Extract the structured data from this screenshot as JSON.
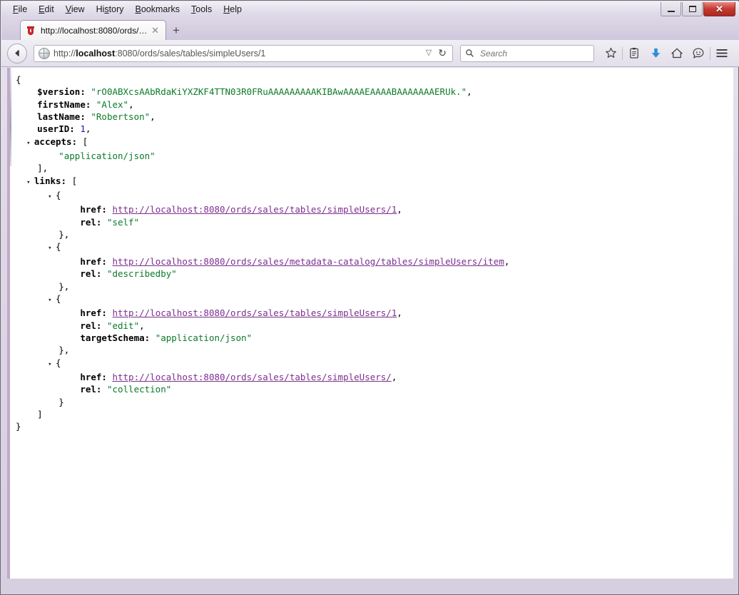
{
  "window": {
    "menubar": [
      {
        "label": "File",
        "accel": "F"
      },
      {
        "label": "Edit",
        "accel": "E"
      },
      {
        "label": "View",
        "accel": "V"
      },
      {
        "label": "History",
        "accel": "s"
      },
      {
        "label": "Bookmarks",
        "accel": "B"
      },
      {
        "label": "Tools",
        "accel": "T"
      },
      {
        "label": "Help",
        "accel": "H"
      }
    ],
    "controls": {
      "minimize": "minimize",
      "maximize": "maximize",
      "close": "✕"
    },
    "frame_color": "#c3a9c8"
  },
  "tabs": {
    "items": [
      {
        "title": "http://localhost:8080/ords/…",
        "favicon": "ords-shield-icon",
        "close_label": "✕"
      }
    ],
    "new_tab_label": "+"
  },
  "navbar": {
    "back_label": "←",
    "url_prefix": "http://",
    "url_host": "localhost",
    "url_rest": ":8080/ords/sales/tables/simpleUsers/1",
    "url_full": "http://localhost:8080/ords/sales/tables/simpleUsers/1",
    "dropdown_label": "▽",
    "reload_label": "↻",
    "search_placeholder": "Search",
    "search_value": "",
    "icons": [
      {
        "name": "bookmark-star-icon",
        "glyph": "☆"
      },
      {
        "name": "reading-list-icon",
        "glyph": "📋"
      },
      {
        "name": "downloads-icon",
        "glyph": "↓"
      },
      {
        "name": "home-icon",
        "glyph": "⌂"
      },
      {
        "name": "sync-chat-icon",
        "glyph": "☺"
      },
      {
        "name": "menu-hamburger-icon",
        "glyph": "≡"
      }
    ],
    "accent_color": "#2f8fd6"
  },
  "json_view": {
    "colors": {
      "key": "#000000",
      "string": "#0b7a28",
      "number": "#1414c8",
      "link": "#7c2f8f"
    },
    "lines": [
      {
        "indent": 0,
        "twisty": "",
        "parts": [
          {
            "t": "brc",
            "v": "{"
          }
        ]
      },
      {
        "indent": 1,
        "twisty": "",
        "parts": [
          {
            "t": "k",
            "v": "$version:"
          },
          {
            "t": "sp",
            "v": " "
          },
          {
            "t": "str",
            "v": "\"rO0ABXcsAAbRdaKiYXZKF4TTN03R0FRuAAAAAAAAAKIBAwAAAAEAAAABAAAAAAAERUk.\""
          },
          {
            "t": "pun",
            "v": ","
          }
        ]
      },
      {
        "indent": 1,
        "twisty": "",
        "parts": [
          {
            "t": "k",
            "v": "firstName:"
          },
          {
            "t": "sp",
            "v": " "
          },
          {
            "t": "str",
            "v": "\"Alex\""
          },
          {
            "t": "pun",
            "v": ","
          }
        ]
      },
      {
        "indent": 1,
        "twisty": "",
        "parts": [
          {
            "t": "k",
            "v": "lastName:"
          },
          {
            "t": "sp",
            "v": " "
          },
          {
            "t": "str",
            "v": "\"Robertson\""
          },
          {
            "t": "pun",
            "v": ","
          }
        ]
      },
      {
        "indent": 1,
        "twisty": "",
        "parts": [
          {
            "t": "k",
            "v": "userID:"
          },
          {
            "t": "sp",
            "v": " "
          },
          {
            "t": "num",
            "v": "1"
          },
          {
            "t": "pun",
            "v": ","
          }
        ]
      },
      {
        "indent": 1,
        "twisty": "▾",
        "parts": [
          {
            "t": "k",
            "v": "accepts:"
          },
          {
            "t": "sp",
            "v": " "
          },
          {
            "t": "brc",
            "v": "["
          }
        ]
      },
      {
        "indent": 2,
        "twisty": "",
        "parts": [
          {
            "t": "str",
            "v": "\"application/json\""
          }
        ]
      },
      {
        "indent": 1,
        "twisty": "",
        "parts": [
          {
            "t": "brc",
            "v": "],"
          }
        ]
      },
      {
        "indent": 1,
        "twisty": "▾",
        "parts": [
          {
            "t": "k",
            "v": "links:"
          },
          {
            "t": "sp",
            "v": " "
          },
          {
            "t": "brc",
            "v": "["
          }
        ]
      },
      {
        "indent": 2,
        "twisty": "▾",
        "parts": [
          {
            "t": "brc",
            "v": "{"
          }
        ]
      },
      {
        "indent": 3,
        "twisty": "",
        "parts": [
          {
            "t": "k",
            "v": "href:"
          },
          {
            "t": "sp",
            "v": " "
          },
          {
            "t": "lnk",
            "v": "http://localhost:8080/ords/sales/tables/simpleUsers/1"
          },
          {
            "t": "pun",
            "v": ","
          }
        ]
      },
      {
        "indent": 3,
        "twisty": "",
        "parts": [
          {
            "t": "k",
            "v": "rel:"
          },
          {
            "t": "sp",
            "v": " "
          },
          {
            "t": "str",
            "v": "\"self\""
          }
        ]
      },
      {
        "indent": 2,
        "twisty": "",
        "parts": [
          {
            "t": "brc",
            "v": "},"
          }
        ]
      },
      {
        "indent": 2,
        "twisty": "▾",
        "parts": [
          {
            "t": "brc",
            "v": "{"
          }
        ]
      },
      {
        "indent": 3,
        "twisty": "",
        "parts": [
          {
            "t": "k",
            "v": "href:"
          },
          {
            "t": "sp",
            "v": " "
          },
          {
            "t": "lnk",
            "v": "http://localhost:8080/ords/sales/metadata-catalog/tables/simpleUsers/item"
          },
          {
            "t": "pun",
            "v": ","
          }
        ]
      },
      {
        "indent": 3,
        "twisty": "",
        "parts": [
          {
            "t": "k",
            "v": "rel:"
          },
          {
            "t": "sp",
            "v": " "
          },
          {
            "t": "str",
            "v": "\"describedby\""
          }
        ]
      },
      {
        "indent": 2,
        "twisty": "",
        "parts": [
          {
            "t": "brc",
            "v": "},"
          }
        ]
      },
      {
        "indent": 2,
        "twisty": "▾",
        "parts": [
          {
            "t": "brc",
            "v": "{"
          }
        ]
      },
      {
        "indent": 3,
        "twisty": "",
        "parts": [
          {
            "t": "k",
            "v": "href:"
          },
          {
            "t": "sp",
            "v": " "
          },
          {
            "t": "lnk",
            "v": "http://localhost:8080/ords/sales/tables/simpleUsers/1"
          },
          {
            "t": "pun",
            "v": ","
          }
        ]
      },
      {
        "indent": 3,
        "twisty": "",
        "parts": [
          {
            "t": "k",
            "v": "rel:"
          },
          {
            "t": "sp",
            "v": " "
          },
          {
            "t": "str",
            "v": "\"edit\""
          },
          {
            "t": "pun",
            "v": ","
          }
        ]
      },
      {
        "indent": 3,
        "twisty": "",
        "parts": [
          {
            "t": "k",
            "v": "targetSchema:"
          },
          {
            "t": "sp",
            "v": " "
          },
          {
            "t": "str",
            "v": "\"application/json\""
          }
        ]
      },
      {
        "indent": 2,
        "twisty": "",
        "parts": [
          {
            "t": "brc",
            "v": "},"
          }
        ]
      },
      {
        "indent": 2,
        "twisty": "▾",
        "parts": [
          {
            "t": "brc",
            "v": "{"
          }
        ]
      },
      {
        "indent": 3,
        "twisty": "",
        "parts": [
          {
            "t": "k",
            "v": "href:"
          },
          {
            "t": "sp",
            "v": " "
          },
          {
            "t": "lnk",
            "v": "http://localhost:8080/ords/sales/tables/simpleUsers/"
          },
          {
            "t": "pun",
            "v": ","
          }
        ]
      },
      {
        "indent": 3,
        "twisty": "",
        "parts": [
          {
            "t": "k",
            "v": "rel:"
          },
          {
            "t": "sp",
            "v": " "
          },
          {
            "t": "str",
            "v": "\"collection\""
          }
        ]
      },
      {
        "indent": 2,
        "twisty": "",
        "parts": [
          {
            "t": "brc",
            "v": "}"
          }
        ]
      },
      {
        "indent": 1,
        "twisty": "",
        "parts": [
          {
            "t": "brc",
            "v": "]"
          }
        ]
      },
      {
        "indent": 0,
        "twisty": "",
        "parts": [
          {
            "t": "brc",
            "v": "}"
          }
        ]
      }
    ]
  }
}
